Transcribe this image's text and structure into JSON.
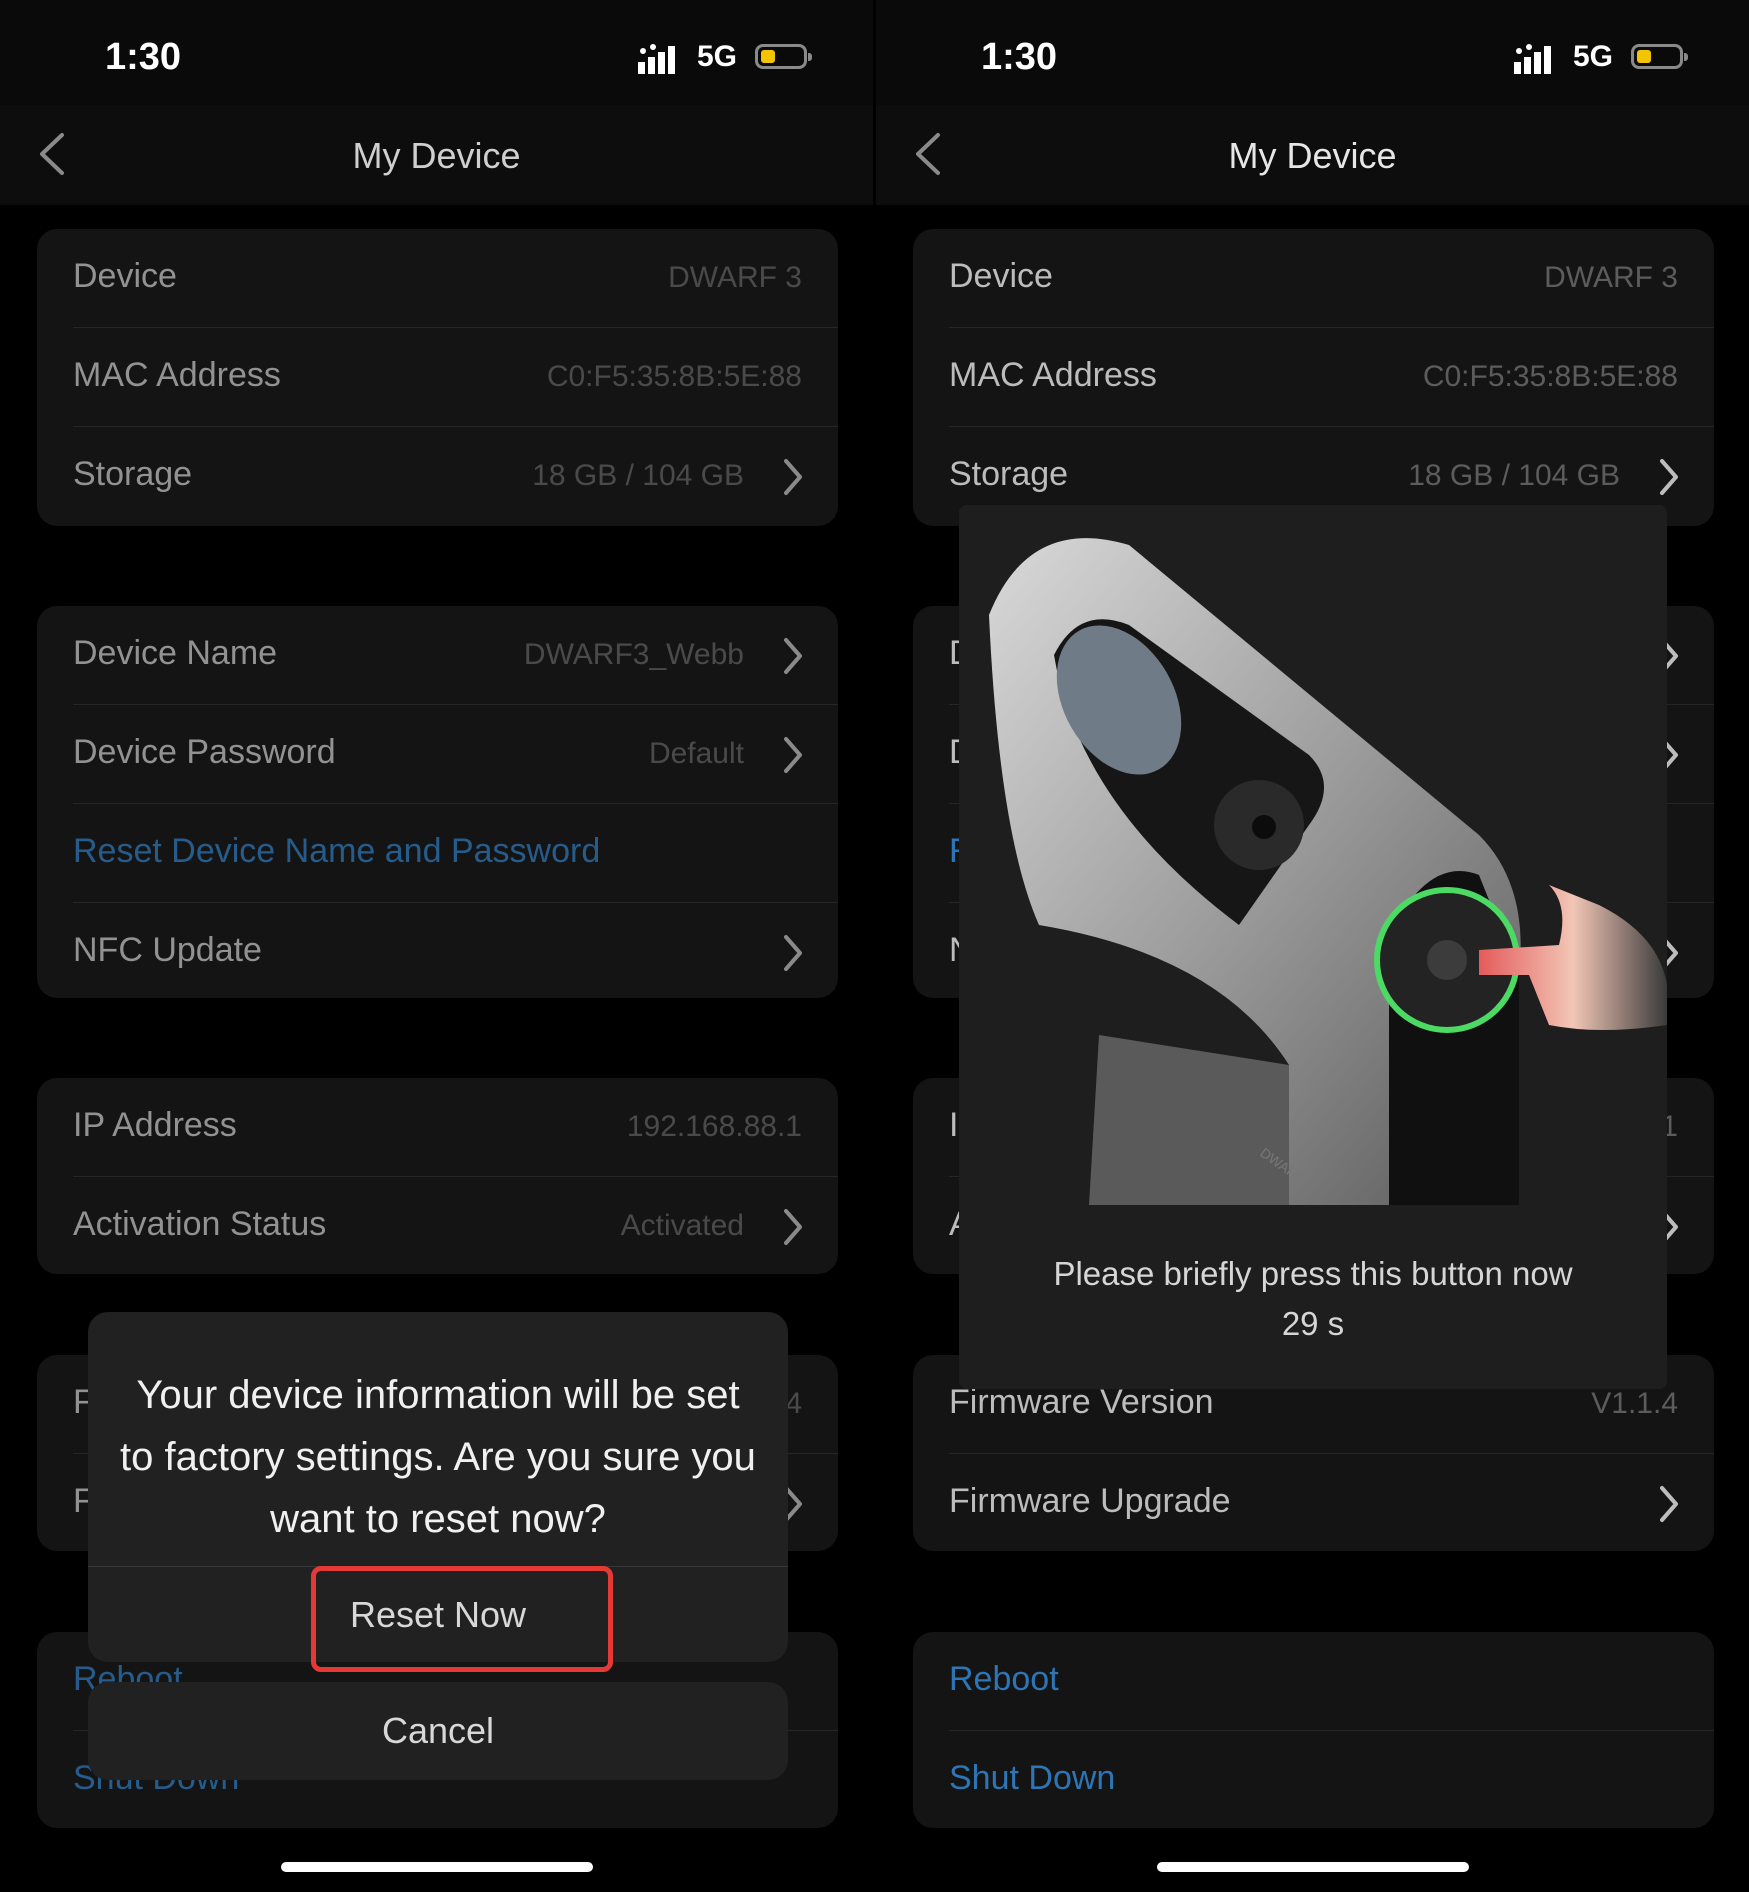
{
  "status": {
    "time": "1:30",
    "network": "5G",
    "battery_level": 0.3
  },
  "nav": {
    "title": "My Device"
  },
  "groups": {
    "info": [
      {
        "label": "Device",
        "value": "DWARF 3",
        "arrow": false
      },
      {
        "label": "MAC Address",
        "value": "C0:F5:35:8B:5E:88",
        "arrow": false
      },
      {
        "label": "Storage",
        "value": "18 GB / 104 GB",
        "arrow": true
      }
    ],
    "identity": [
      {
        "label": "Device Name",
        "value": "DWARF3_Webb",
        "arrow": true
      },
      {
        "label": "Device Password",
        "value": "Default",
        "arrow": true
      },
      {
        "label": "Reset Device Name and Password",
        "value": "",
        "arrow": false,
        "link": true
      },
      {
        "label": "NFC Update",
        "value": "",
        "arrow": true
      }
    ],
    "network": [
      {
        "label": "IP Address",
        "value": "192.168.88.1",
        "arrow": false
      },
      {
        "label": "Activation Status",
        "value": "Activated",
        "arrow": true
      }
    ],
    "firmware": [
      {
        "label": "Firmware Version",
        "value": "V1.1.4",
        "arrow": false
      },
      {
        "label": "Firmware Upgrade",
        "value": "",
        "arrow": true
      }
    ],
    "power": [
      {
        "label": "Reboot",
        "value": "",
        "arrow": false,
        "link": true
      },
      {
        "label": "Shut Down",
        "value": "",
        "arrow": false,
        "link": true
      }
    ]
  },
  "dialog": {
    "message": "Your device information will be set to factory settings. Are you sure you want to reset now?",
    "confirm": "Reset Now",
    "cancel": "Cancel"
  },
  "popup": {
    "prompt": "Please briefly press this button now",
    "countdown": "29 s",
    "product_text": "DWARF"
  },
  "colors": {
    "link": "#2d75b5",
    "ring": "#4cd964",
    "highlight": "#e53935",
    "battery": "#f3c400"
  }
}
